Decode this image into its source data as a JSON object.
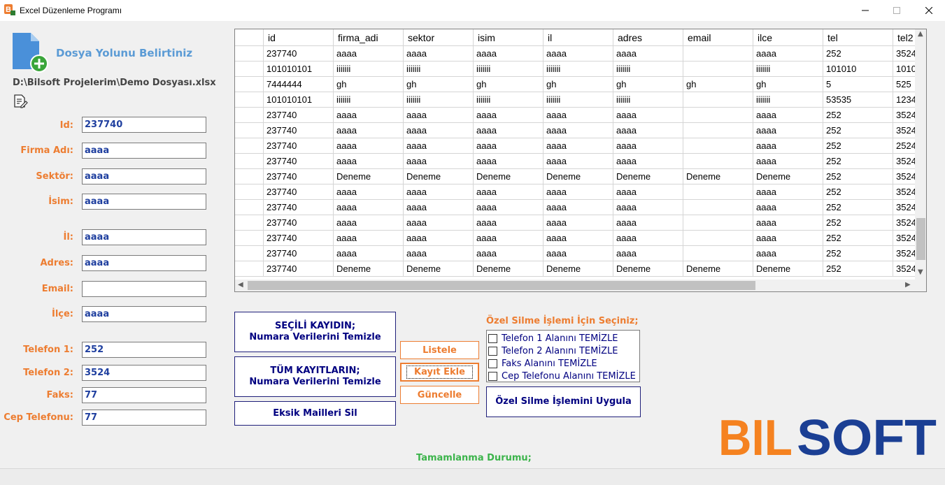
{
  "window": {
    "title": "Excel Düzenleme Programı"
  },
  "file": {
    "heading": "Dosya Yolunu Belirtiniz",
    "path": "D:\\Bilsoft Projelerim\\Demo Dosyası.xlsx"
  },
  "form": {
    "fields": [
      {
        "label": "Id:",
        "value": "237740"
      },
      {
        "label": "Firma Adı:",
        "value": "aaaa"
      },
      {
        "label": "Sektör:",
        "value": "aaaa"
      },
      {
        "label": "İsim:",
        "value": "aaaa"
      },
      {
        "label": "İl:",
        "value": "aaaa"
      },
      {
        "label": "Adres:",
        "value": "aaaa"
      },
      {
        "label": "Email:",
        "value": ""
      },
      {
        "label": "İlçe:",
        "value": "aaaa"
      },
      {
        "label": "Telefon 1:",
        "value": "252"
      },
      {
        "label": "Telefon 2:",
        "value": "3524"
      },
      {
        "label": "Faks:",
        "value": "77"
      },
      {
        "label": "Cep Telefonu:",
        "value": "77"
      }
    ]
  },
  "grid": {
    "columns": [
      "",
      "id",
      "firma_adi",
      "sektor",
      "isim",
      "il",
      "adres",
      "email",
      "ilce",
      "tel",
      "tel2"
    ],
    "rows": [
      [
        "",
        "237740",
        "aaaa",
        "aaaa",
        "aaaa",
        "aaaa",
        "aaaa",
        "",
        "aaaa",
        "252",
        "3524"
      ],
      [
        "",
        "101010101",
        "iiiiiii",
        "iiiiiii",
        "iiiiiii",
        "iiiiiii",
        "iiiiiii",
        "",
        "iiiiiii",
        "101010",
        "1010"
      ],
      [
        "",
        "7444444",
        "gh",
        "gh",
        "gh",
        "gh",
        "gh",
        "gh",
        "gh",
        "5",
        "525"
      ],
      [
        "",
        "101010101",
        "iiiiiii",
        "iiiiiii",
        "iiiiiii",
        "iiiiiii",
        "iiiiiii",
        "",
        "iiiiiii",
        "53535",
        "1234"
      ],
      [
        "",
        "237740",
        "aaaa",
        "aaaa",
        "aaaa",
        "aaaa",
        "aaaa",
        "",
        "aaaa",
        "252",
        "3524"
      ],
      [
        "",
        "237740",
        "aaaa",
        "aaaa",
        "aaaa",
        "aaaa",
        "aaaa",
        "",
        "aaaa",
        "252",
        "3524"
      ],
      [
        "",
        "237740",
        "aaaa",
        "aaaa",
        "aaaa",
        "aaaa",
        "aaaa",
        "",
        "aaaa",
        "252",
        "2524"
      ],
      [
        "",
        "237740",
        "aaaa",
        "aaaa",
        "aaaa",
        "aaaa",
        "aaaa",
        "",
        "aaaa",
        "252",
        "3524"
      ],
      [
        "",
        "237740",
        "Deneme",
        "Deneme",
        "Deneme",
        "Deneme",
        "Deneme",
        "Deneme",
        "Deneme",
        "252",
        "3524"
      ],
      [
        "",
        "237740",
        "aaaa",
        "aaaa",
        "aaaa",
        "aaaa",
        "aaaa",
        "",
        "aaaa",
        "252",
        "3524"
      ],
      [
        "",
        "237740",
        "aaaa",
        "aaaa",
        "aaaa",
        "aaaa",
        "aaaa",
        "",
        "aaaa",
        "252",
        "3524"
      ],
      [
        "",
        "237740",
        "aaaa",
        "aaaa",
        "aaaa",
        "aaaa",
        "aaaa",
        "",
        "aaaa",
        "252",
        "3524"
      ],
      [
        "",
        "237740",
        "aaaa",
        "aaaa",
        "aaaa",
        "aaaa",
        "aaaa",
        "",
        "aaaa",
        "252",
        "3524"
      ],
      [
        "",
        "237740",
        "aaaa",
        "aaaa",
        "aaaa",
        "aaaa",
        "aaaa",
        "",
        "aaaa",
        "252",
        "3524"
      ],
      [
        "",
        "237740",
        "Deneme",
        "Deneme",
        "Deneme",
        "Deneme",
        "Deneme",
        "Deneme",
        "Deneme",
        "252",
        "3524"
      ]
    ]
  },
  "buttons": {
    "clean_selected": [
      "SEÇİLİ KAYIDIN;",
      "Numara Verilerini Temizle"
    ],
    "clean_all": [
      "TÜM KAYITLARIN;",
      "Numara Verilerini Temizle"
    ],
    "delete_missing_mails": "Eksik Mailleri Sil",
    "list": "Listele",
    "add_record": "Kayıt Ekle",
    "update": "Güncelle",
    "apply_special_delete": "Özel Silme İşlemini Uygula"
  },
  "special_delete": {
    "heading": "Özel Silme İşlemi İçin Seçiniz;",
    "options": [
      {
        "label": "Telefon 1 Alanını TEMİZLE",
        "checked": false
      },
      {
        "label": "Telefon 2 Alanını TEMİZLE",
        "checked": false
      },
      {
        "label": "Faks Alanını TEMİZLE",
        "checked": false
      },
      {
        "label": "Cep Telefonu Alanını TEMİZLE",
        "checked": false
      }
    ]
  },
  "logo": {
    "text_orange": "BIL",
    "text_blue": "SOFT",
    "color_orange": "#f58220",
    "color_blue": "#1b3f94"
  },
  "status": {
    "label": "Tamamlanma Durumu;"
  },
  "colors": {
    "label_orange": "#ed7d31",
    "navy": "#000080",
    "heading_blue": "#5b9bd5",
    "status_green": "#3cb44b"
  }
}
